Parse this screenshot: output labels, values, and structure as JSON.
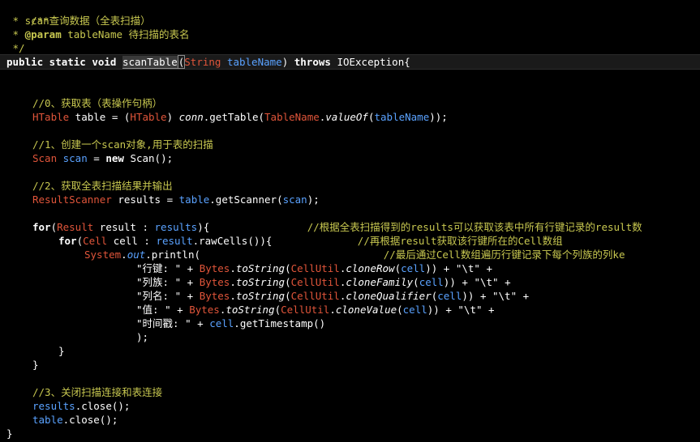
{
  "doc": {
    "open": "/**",
    "star": " * ",
    "l1": "scan查询数据（全表扫描）",
    "tag": "@param",
    "param_name": " tableName ",
    "param_desc": "待扫描的表名",
    "close": " */"
  },
  "signature": {
    "mods": "public static void ",
    "name": "scanTable",
    "paren_open": "(",
    "ptype": "String",
    "pname": " tableName",
    "paren_close": ") ",
    "throws": "throws ",
    "exc": "IOException{"
  },
  "s0": {
    "comment": "//0、获取表（表操作句柄）",
    "type": "HTable",
    "var": " table = (",
    "cast": "HTable",
    "rest1": ") ",
    "conn": "conn",
    "rest2": ".getTable(",
    "tn": "TableName",
    "dot": ".",
    "valueOf": "valueOf",
    "arg_open": "(",
    "arg": "tableName",
    "end": "));"
  },
  "s1": {
    "comment": "//1、创建一个scan对象,用于表的扫描",
    "type": "Scan",
    "var": " scan",
    "eq": " = ",
    "new": "new ",
    "ctor": "Scan();"
  },
  "s2": {
    "comment": "//2、获取全表扫描结果并输出",
    "type": "ResultScanner",
    "var": " results = ",
    "obj": "table",
    "call": ".getScanner(",
    "arg": "scan",
    "end": ");"
  },
  "loop1": {
    "for": "for",
    "open": "(",
    "type": "Result",
    "var": " result : ",
    "coll": "results",
    "close": "){",
    "pad": "                ",
    "comment": "//根据全表扫描得到的results可以获取该表中所有行键记录的result数"
  },
  "loop2": {
    "for": "for",
    "open": "(",
    "type": "Cell",
    "var": " cell : ",
    "obj": "result",
    "call": ".rawCells()){",
    "pad": "              ",
    "comment": "//再根据result获取该行键所在的Cell数组"
  },
  "println": {
    "sys": "System",
    "dot": ".",
    "out": "out",
    "call": ".println(",
    "pad": "                              ",
    "comment": "//最后通过Cell数组遍历行键记录下每个列族的列ke"
  },
  "rows": [
    {
      "str": "\"行键: \"",
      "util": "CellUtil",
      "fn": "cloneRow"
    },
    {
      "str": "\"列族: \"",
      "util": "CellUtil",
      "fn": "cloneFamily"
    },
    {
      "str": "\"列名: \"",
      "util": "CellUtil",
      "fn": "cloneQualifier"
    },
    {
      "str": "\"值: \"",
      "util": "CellUtil",
      "fn": "cloneValue"
    }
  ],
  "concat": {
    "plus": " + ",
    "bytes": "Bytes",
    "tostr": "toString",
    "cell": "cell",
    "tab": "\"\\t\"",
    "ts_label": "\"时间戳: \"",
    "ts_call": ".getTimestamp()",
    "close": ");"
  },
  "braces": {
    "inner": "}",
    "outer": "}",
    "method": "}"
  },
  "s3": {
    "comment": "//3、关闭扫描连接和表连接",
    "results": "results",
    "results_close": ".close();",
    "table": "table",
    "table_close": ".close();"
  }
}
